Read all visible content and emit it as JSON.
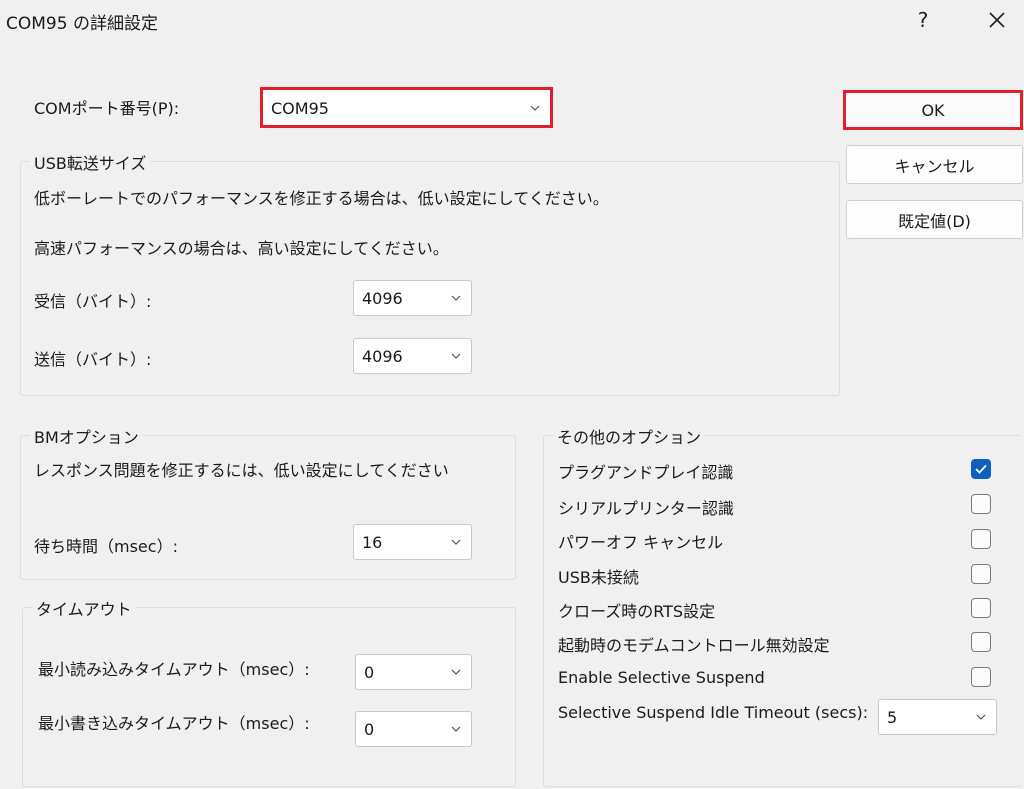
{
  "window": {
    "title": "COM95 の詳細設定",
    "help_icon": "?",
    "close_icon": "close-icon"
  },
  "com_port": {
    "label": "COMポート番号(P):",
    "value": "COM95"
  },
  "buttons": {
    "ok": "OK",
    "cancel": "キャンセル",
    "default": "既定値(D)"
  },
  "usb": {
    "title": "USB転送サイズ",
    "note1": "低ボーレートでのパフォーマンスを修正する場合は、低い設定にしてください。",
    "note2": "高速パフォーマンスの場合は、高い設定にしてください。",
    "receive_label": "受信（バイト）:",
    "receive_value": "4096",
    "transmit_label": "送信（バイト）:",
    "transmit_value": "4096"
  },
  "bm": {
    "title": "BMオプション",
    "note": "レスポンス問題を修正するには、低い設定にしてください",
    "latency_label": "待ち時間（msec）:",
    "latency_value": "16"
  },
  "timeouts": {
    "title": "タイムアウト",
    "read_label": "最小読み込みタイムアウト（msec）:",
    "read_value": "0",
    "write_label": "最小書き込みタイムアウト（msec）:",
    "write_value": "0"
  },
  "misc": {
    "title": "その他のオプション",
    "options": [
      {
        "label": "プラグアンドプレイ認識",
        "checked": true
      },
      {
        "label": "シリアルプリンター認識",
        "checked": false
      },
      {
        "label": "パワーオフ キャンセル",
        "checked": false
      },
      {
        "label": "USB未接続",
        "checked": false
      },
      {
        "label": "クローズ時のRTS設定",
        "checked": false
      },
      {
        "label": "起動時のモデムコントロール無効設定",
        "checked": false
      },
      {
        "label": "Enable Selective Suspend",
        "checked": false
      }
    ],
    "idle_timeout_label": "Selective Suspend Idle Timeout (secs):",
    "idle_timeout_value": "5"
  },
  "colors": {
    "highlight": "#e0202a",
    "checkbox_accent": "#0f5fc0",
    "background": "#f0f0f0"
  }
}
